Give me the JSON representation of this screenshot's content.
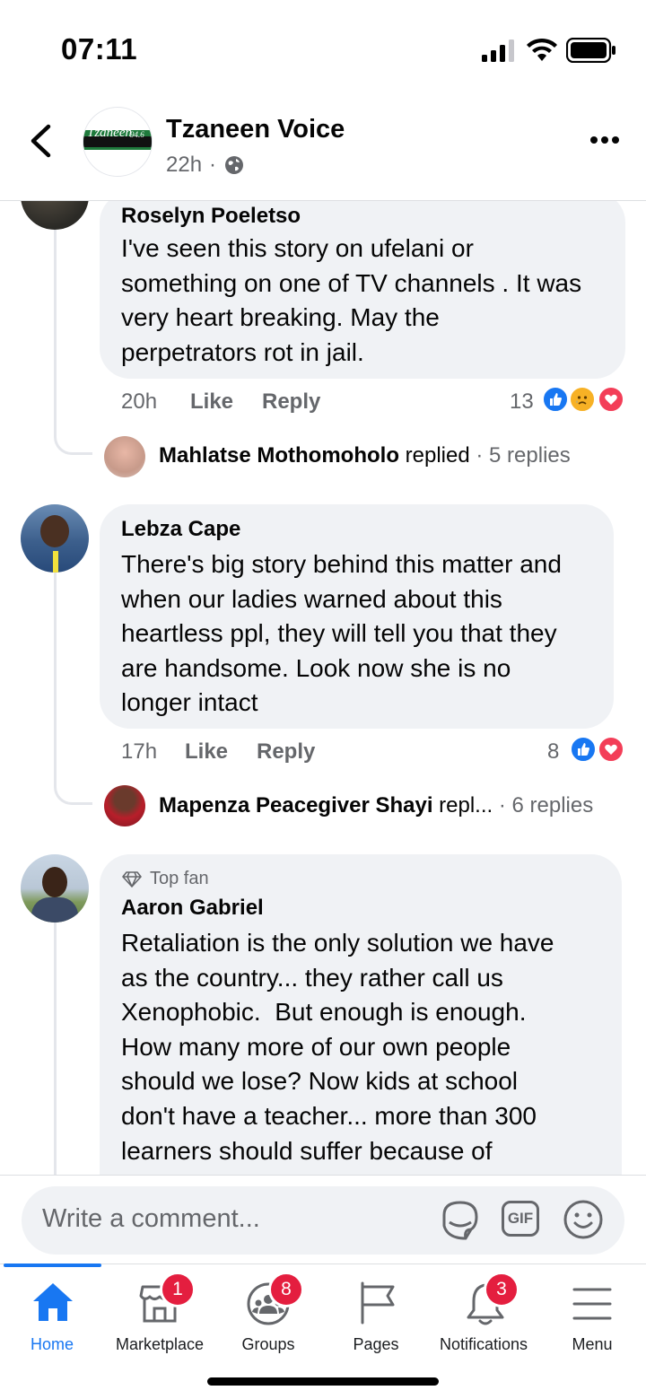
{
  "status_bar": {
    "time": "07:11"
  },
  "header": {
    "page_name": "Tzaneen Voice",
    "post_time": "22h",
    "separator": "·",
    "logo_text": "Tzaneen",
    "logo_suffix": "94.6"
  },
  "comments": [
    {
      "author": "Roselyn Poeletso",
      "text": "I've seen this story on ufelani or\nsomething on one of TV channels . It was\nvery heart breaking. May the\nperpetrators rot in jail.",
      "time": "20h",
      "like_label": "Like",
      "reply_label": "Reply",
      "reaction_count": "13",
      "reactions": [
        "like-icon",
        "sad-icon",
        "love-icon"
      ],
      "reply_preview": {
        "name": "Mahlatse Mothomoholo",
        "action": "replied",
        "count": "· 5 replies"
      }
    },
    {
      "author": "Lebza Cape",
      "text": "There's big story behind this matter and\nwhen our ladies warned about this\nheartless ppl, they will tell you that they\nare handsome. Look now she is no\nlonger intact",
      "time": "17h",
      "like_label": "Like",
      "reply_label": "Reply",
      "reaction_count": "8",
      "reactions": [
        "like-icon",
        "love-icon"
      ],
      "reply_preview": {
        "name": "Mapenza Peacegiver Shayi",
        "action": "repl...",
        "count": "· 6 replies"
      }
    },
    {
      "badge": "Top fan",
      "author": "Aaron Gabriel",
      "text": "Retaliation is the only solution we have\nas the country... they rather call us\nXenophobic.  But enough is enough.\nHow many more of our own people\nshould we lose? Now kids at school\ndon't have a teacher... more than 300\nlearners should suffer because of"
    }
  ],
  "composer": {
    "placeholder": "Write a comment...",
    "gif_label": "GIF"
  },
  "tab_bar": {
    "tabs": [
      {
        "label": "Home",
        "icon": "home-icon",
        "active": true
      },
      {
        "label": "Marketplace",
        "icon": "marketplace-icon",
        "badge": "1"
      },
      {
        "label": "Groups",
        "icon": "groups-icon",
        "badge": "8"
      },
      {
        "label": "Pages",
        "icon": "flag-icon"
      },
      {
        "label": "Notifications",
        "icon": "bell-icon",
        "badge": "3"
      },
      {
        "label": "Menu",
        "icon": "menu-icon"
      }
    ]
  },
  "colors": {
    "accent": "#1877f2",
    "badge": "#e41e3f",
    "bubble": "#f0f2f5",
    "secondary_text": "#65676b"
  }
}
